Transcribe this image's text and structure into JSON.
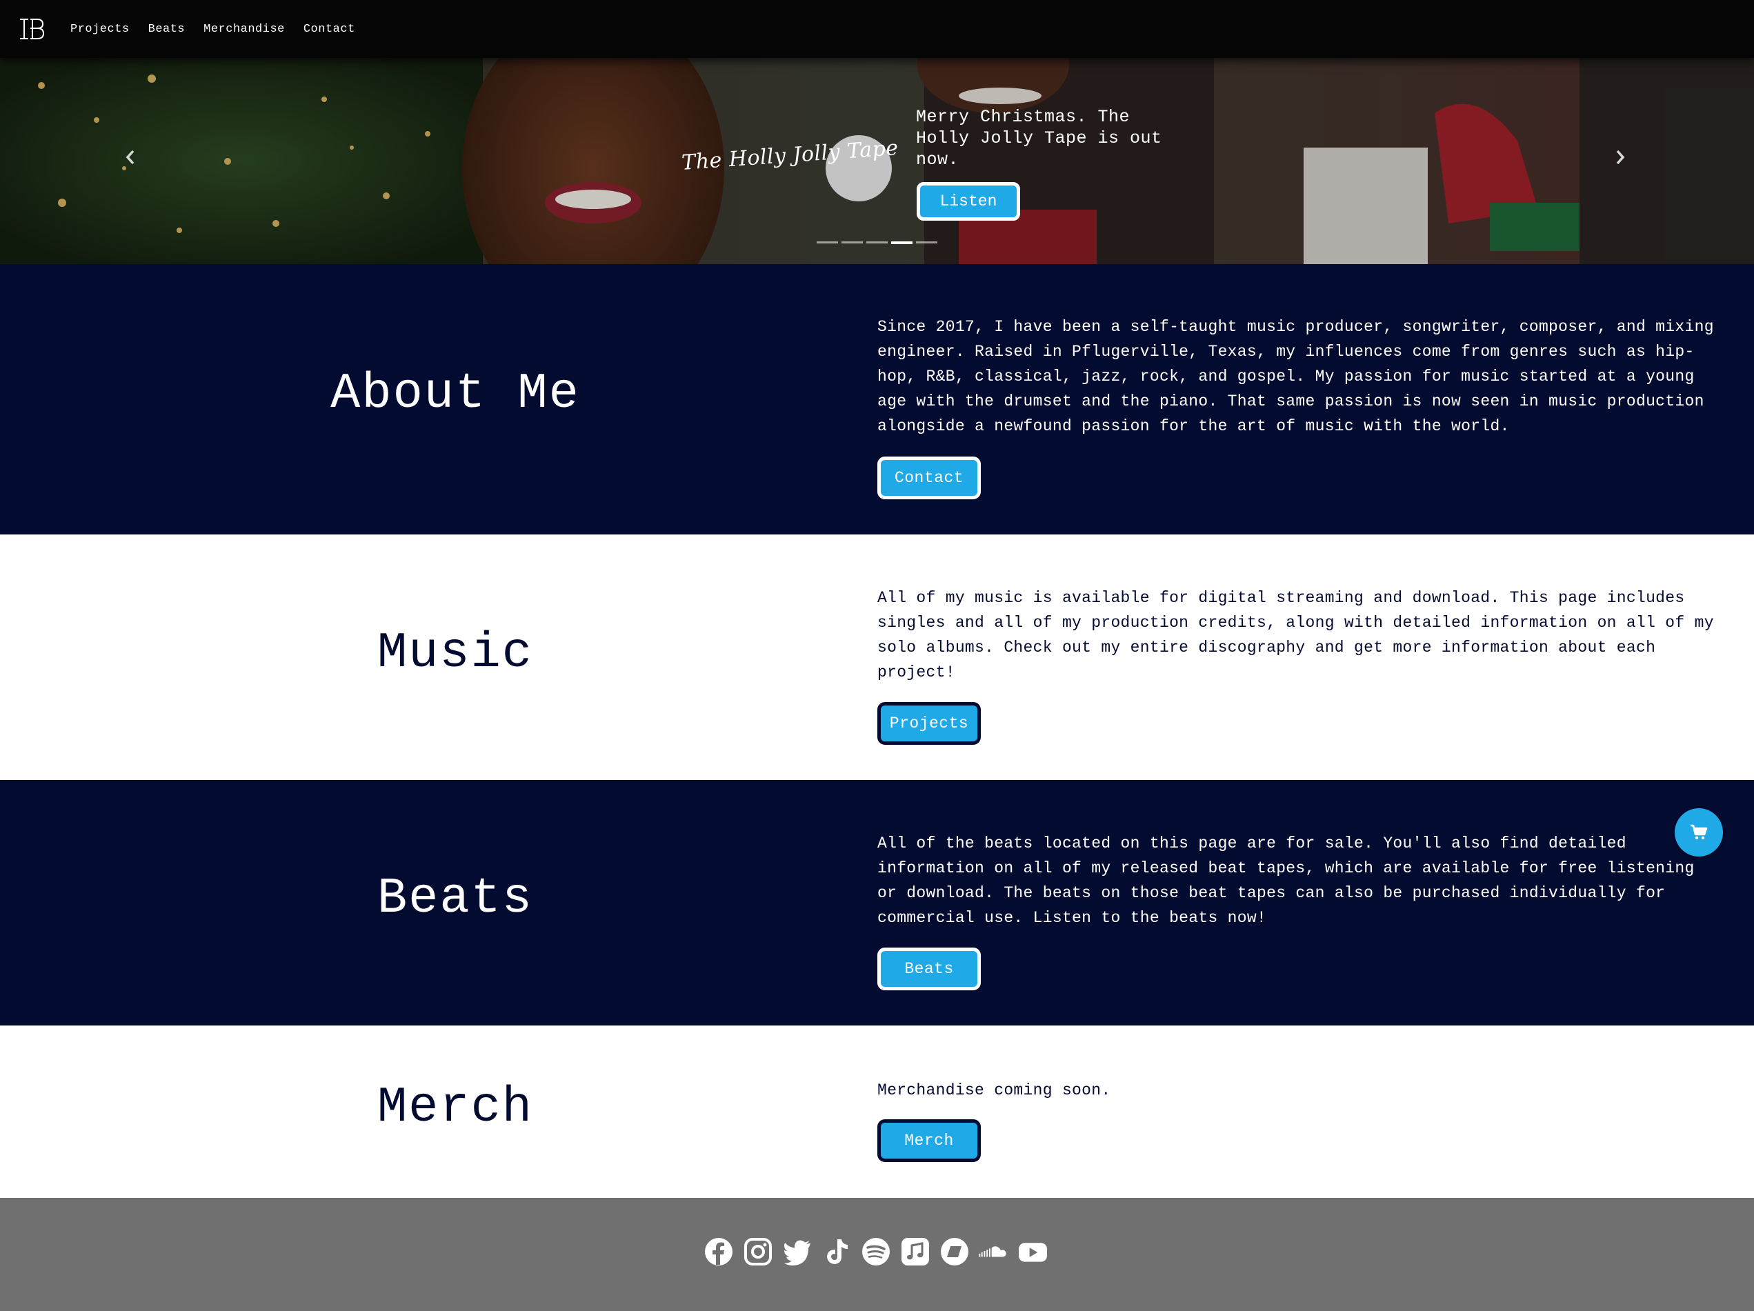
{
  "nav": {
    "logo_text": "TB",
    "links": [
      "Projects",
      "Beats",
      "Merchandise",
      "Contact"
    ]
  },
  "hero": {
    "script_title": "The Holly Jolly Tape",
    "caption": "Merry Christmas. The Holly Jolly Tape is out now.",
    "button_label": "Listen",
    "prev_icon": "chevron-left-icon",
    "next_icon": "chevron-right-icon",
    "indicator_count": 5,
    "active_indicator": 4
  },
  "sections": {
    "about": {
      "title": "About Me",
      "text": "Since 2017, I have been a self-taught music producer, songwriter, composer, and mixing engineer. Raised in Pflugerville, Texas, my influences come from genres such as hip-hop, R&B, classical, jazz, rock, and gospel. My passion for music started at a young age with the drumset and the piano. That same passion is now seen in music production alongside a newfound passion for the art of music with the world.",
      "button_label": "Contact"
    },
    "music": {
      "title": "Music",
      "text": "All of my music is available for digital streaming and download. This page includes singles and all of my production credits, along with detailed information on all of my solo albums. Check out my entire discography and get more information about each project!",
      "button_label": "Projects"
    },
    "beats": {
      "title": "Beats",
      "text": "All of the beats located on this page are for sale. You'll also find detailed information on all of my released beat tapes, which are available for free listening or download. The beats on those beat tapes can also be purchased individually for commercial use. Listen to the beats now!",
      "button_label": "Beats"
    },
    "merch": {
      "title": "Merch",
      "text": "Merchandise coming soon.",
      "button_label": "Merch"
    }
  },
  "cart": {
    "icon": "shopping-cart-icon"
  },
  "footer": {
    "social_icons": [
      "facebook-icon",
      "instagram-icon",
      "twitter-icon",
      "tiktok-icon",
      "spotify-icon",
      "apple-music-icon",
      "bandcamp-icon",
      "soundcloud-icon",
      "youtube-icon"
    ]
  },
  "colors": {
    "navy": "#040b30",
    "accent": "#1fa9e6",
    "footer": "#707070",
    "navbar": "#050505"
  }
}
